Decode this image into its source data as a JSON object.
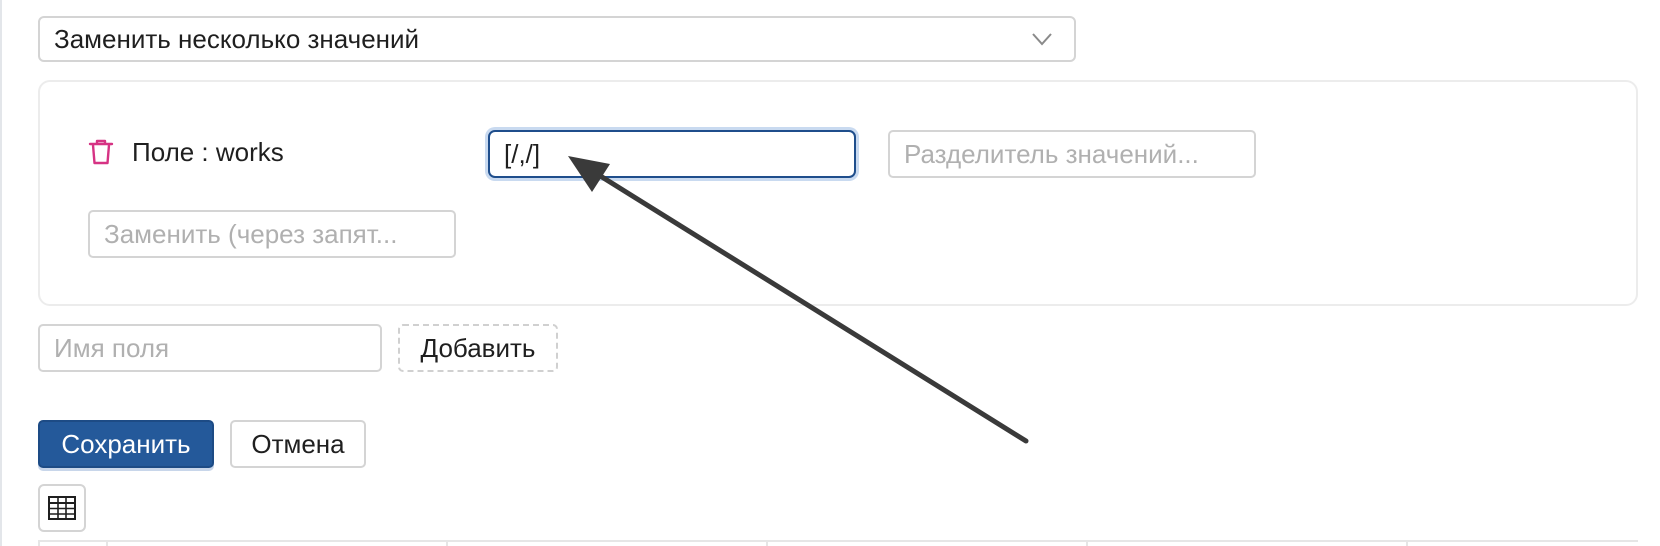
{
  "operation": {
    "selected": "Заменить несколько значений"
  },
  "rule": {
    "field_label": "Поле : works",
    "regex_value": "[/,/]",
    "separator_placeholder": "Разделитель значений...",
    "replace_placeholder": "Заменить (через запят..."
  },
  "new_field": {
    "placeholder": "Имя поля",
    "add_label": "Добавить"
  },
  "actions": {
    "save_label": "Сохранить",
    "cancel_label": "Отмена"
  },
  "icons": {
    "operation_toggle": "chevron-down-icon",
    "delete_rule": "trash-icon",
    "table_view": "table-icon",
    "annotation": "arrow-annotation"
  },
  "colors": {
    "primary": "#24599a",
    "focus_border": "#1f4e8c",
    "delete": "#d63384",
    "annotation": "#3a3a3a"
  }
}
